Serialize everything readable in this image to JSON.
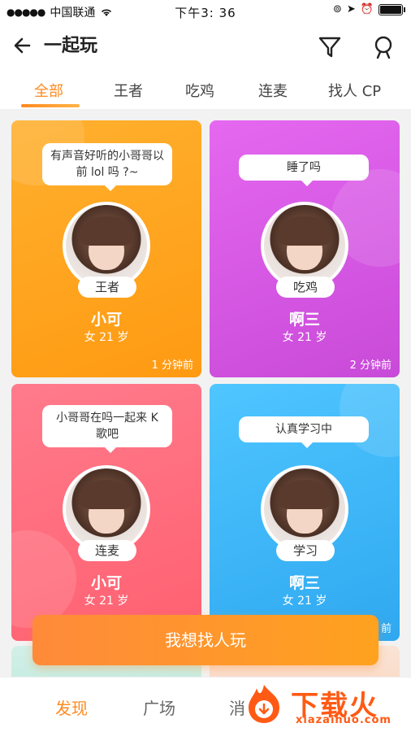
{
  "status_bar": {
    "carrier": "中国联通",
    "time": "下午3: 36"
  },
  "nav": {
    "title": "一起玩",
    "back_icon": "arrow-left-icon",
    "filter_icon": "filter-icon",
    "profile_icon": "person-icon"
  },
  "tabs": [
    "全部",
    "王者",
    "吃鸡",
    "连麦",
    "找人 CP"
  ],
  "active_tab": 0,
  "cards": [
    {
      "bubble": "有声音好听的小哥哥以前 lol 吗 ?~",
      "tag": "王者",
      "name": "小可",
      "meta": "女 21 岁",
      "time": "1 分钟前",
      "color_from": "#ffb02e",
      "color_to": "#ff9a12"
    },
    {
      "bubble": "睡了吗",
      "tag": "吃鸡",
      "name": "啊三",
      "meta": "女 21 岁",
      "time": "2 分钟前",
      "color_from": "#e568f0",
      "color_to": "#c84ad8"
    },
    {
      "bubble": "小哥哥在吗一起来 K 歌吧",
      "tag": "连麦",
      "name": "小可",
      "meta": "女 21 岁",
      "time": "",
      "color_from": "#ff7b8c",
      "color_to": "#ff6070"
    },
    {
      "bubble": "认真学习中",
      "tag": "学习",
      "name": "啊三",
      "meta": "女 21 岁",
      "time": "前",
      "color_from": "#4fc6ff",
      "color_to": "#2fa8f0"
    }
  ],
  "cta_label": "我想找人玩",
  "tabbar": [
    "发现",
    "广场",
    "消"
  ],
  "watermark": {
    "brand": "下载火",
    "url": "xiazaihuo.com"
  }
}
